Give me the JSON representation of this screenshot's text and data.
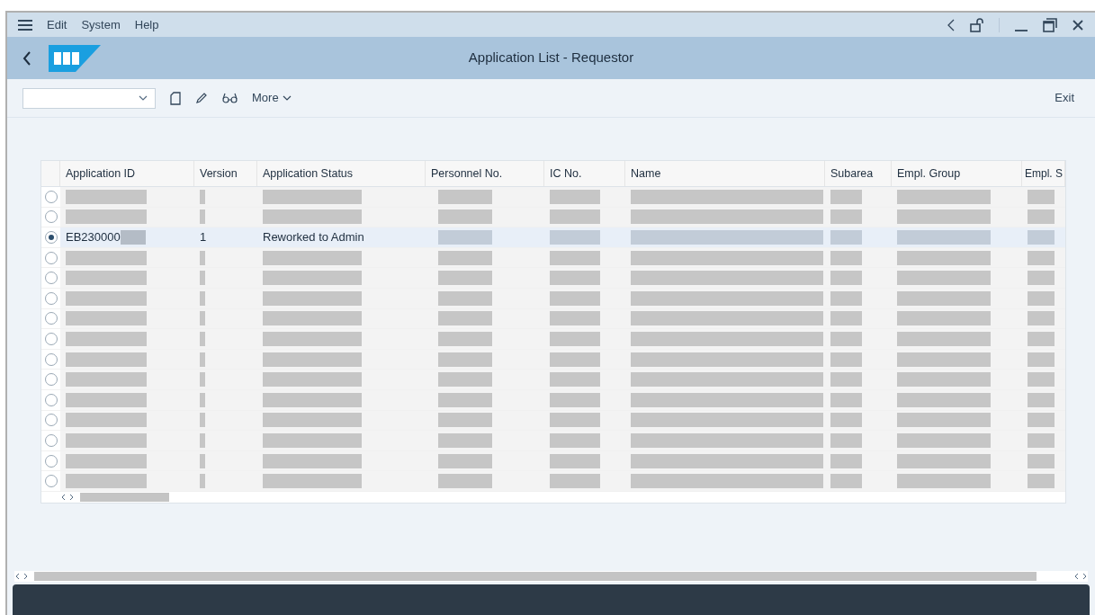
{
  "menu_bar": {
    "items": [
      "Edit",
      "System",
      "Help"
    ]
  },
  "title_bar": {
    "title": "Application List - Requestor"
  },
  "toolbar": {
    "more_label": "More",
    "exit_label": "Exit"
  },
  "table": {
    "columns": [
      "Application ID",
      "Version",
      "Application Status",
      "Personnel No.",
      "IC No.",
      "Name",
      "Subarea",
      "Empl. Group",
      "Empl. S"
    ],
    "rows": [
      {
        "selected": false,
        "redacted": true
      },
      {
        "selected": false,
        "redacted": true
      },
      {
        "selected": true,
        "redacted": false,
        "cells": [
          "EB230000",
          "1",
          "Reworked to Admin"
        ]
      },
      {
        "selected": false,
        "redacted": true
      },
      {
        "selected": false,
        "redacted": true
      },
      {
        "selected": false,
        "redacted": true
      },
      {
        "selected": false,
        "redacted": true
      },
      {
        "selected": false,
        "redacted": true
      },
      {
        "selected": false,
        "redacted": true
      },
      {
        "selected": false,
        "redacted": true
      },
      {
        "selected": false,
        "redacted": true
      },
      {
        "selected": false,
        "redacted": true
      },
      {
        "selected": false,
        "redacted": true
      },
      {
        "selected": false,
        "redacted": true
      },
      {
        "selected": false,
        "redacted": true
      }
    ]
  }
}
